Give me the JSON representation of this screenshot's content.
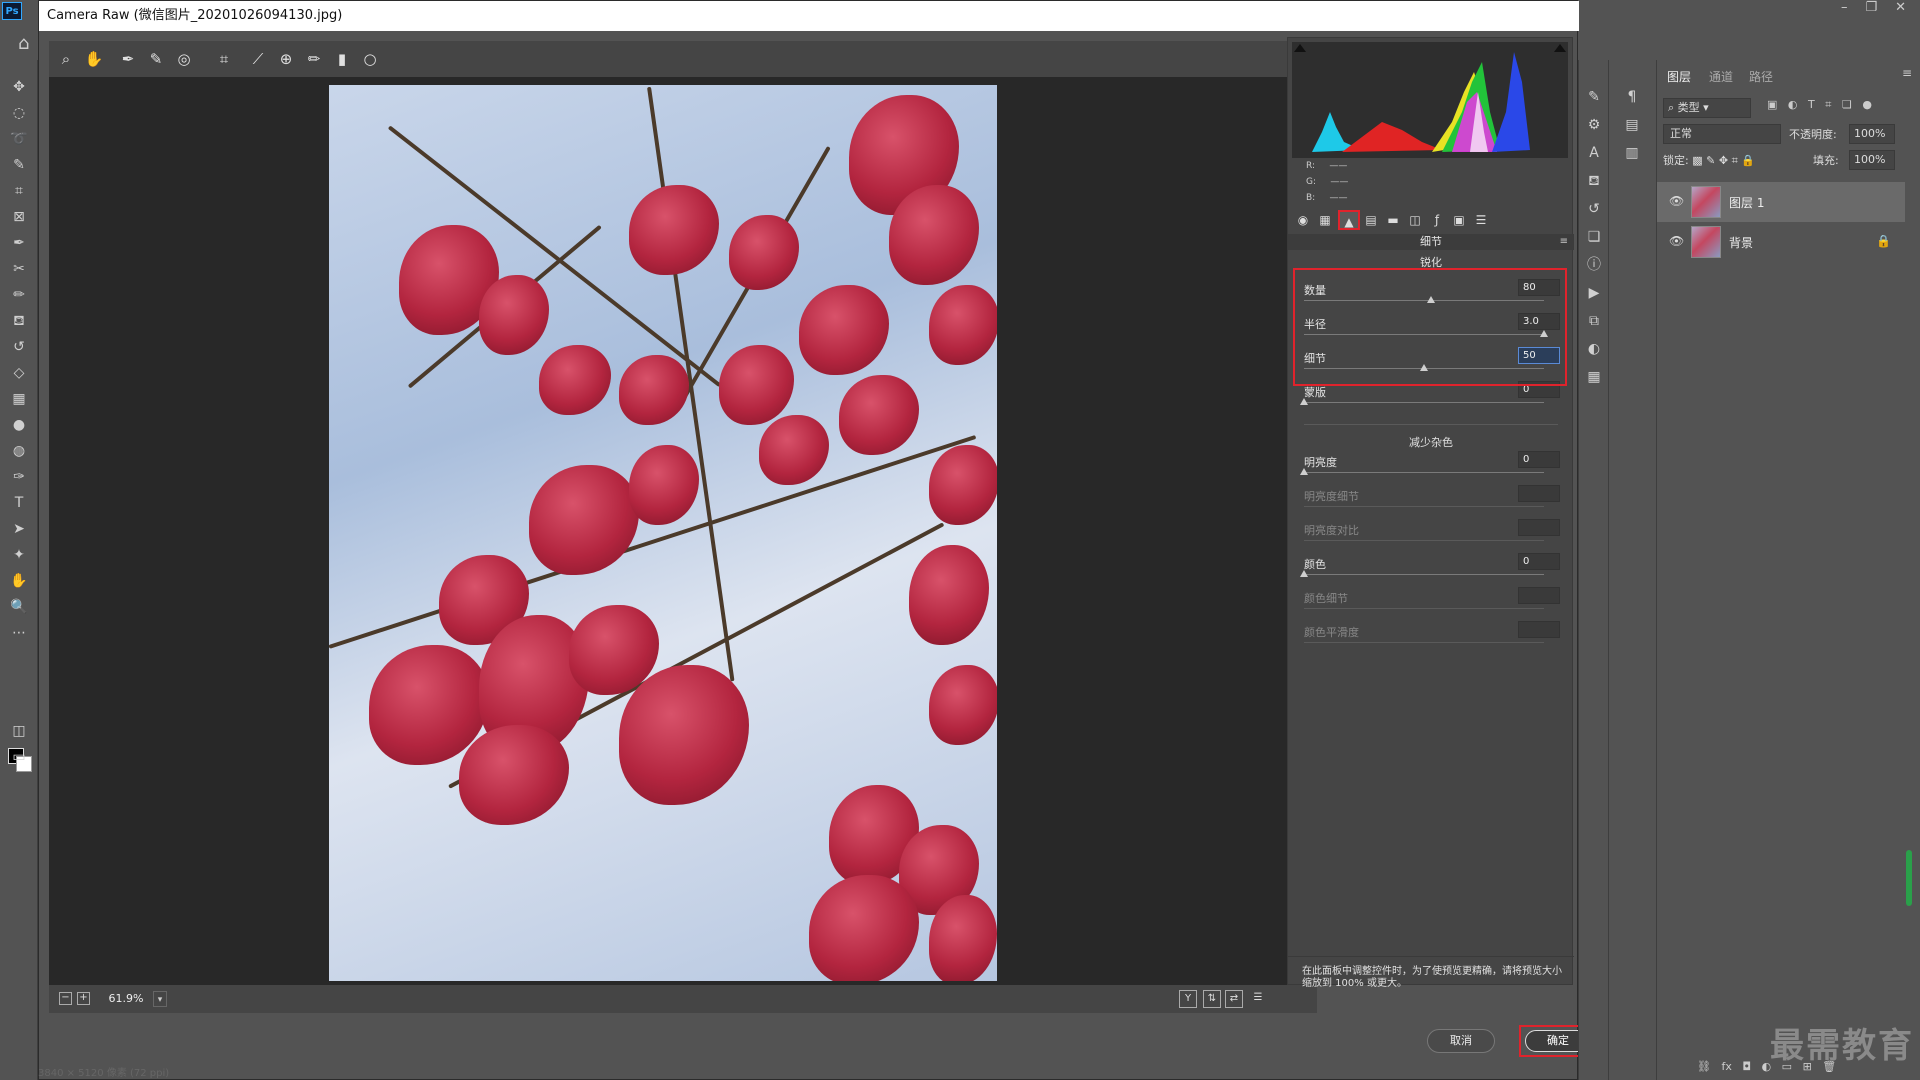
{
  "dialog": {
    "title": "Camera Raw (微信图片_20201026094130.jpg)"
  },
  "app": {
    "logo_text": "Ps",
    "window_controls": [
      "–",
      "❐",
      "✕"
    ]
  },
  "histogram": {
    "rgb": {
      "r": "R:",
      "g": "G:",
      "b": "B:",
      "r_val": "——",
      "g_val": "——",
      "b_val": "——"
    }
  },
  "panel": {
    "title": "细节",
    "sharpen": {
      "title": "锐化",
      "amount": {
        "label": "数量",
        "value": "80",
        "level": 0.53
      },
      "radius": {
        "label": "半径",
        "value": "3.0",
        "level": 1.0
      },
      "detail": {
        "label": "细节",
        "value": "50",
        "level": 0.5
      },
      "masking": {
        "label": "蒙版",
        "value": "0",
        "level": 0
      }
    },
    "noise": {
      "title": "减少杂色",
      "luminance": {
        "label": "明亮度",
        "value": "0",
        "level": 0
      },
      "luminance_detail": {
        "label": "明亮度细节",
        "value": ""
      },
      "luminance_contrast": {
        "label": "明亮度对比",
        "value": ""
      },
      "color": {
        "label": "颜色",
        "value": "0",
        "level": 0
      },
      "color_detail": {
        "label": "颜色细节",
        "value": ""
      },
      "color_smoothness": {
        "label": "颜色平滑度",
        "value": ""
      }
    },
    "note": "在此面板中调整控件时，为了使预览更精确，请将预览大小缩放到 100% 或更大。"
  },
  "statusbar": {
    "zoom": "61.9%",
    "zoom_minus": "−",
    "zoom_plus": "+",
    "view_y": "Y"
  },
  "buttons": {
    "cancel": "取消",
    "ok": "确定"
  },
  "layers": {
    "tabs": [
      "图层",
      "通道",
      "路径"
    ],
    "filter": "类型",
    "blend_mode": "正常",
    "opacity_label": "不透明度:",
    "opacity_value": "100%",
    "lock_label": "锁定:",
    "fill_label": "填充:",
    "fill_value": "100%",
    "items": [
      {
        "name": "图层 1",
        "selected": true
      },
      {
        "name": "背景",
        "selected": false
      }
    ]
  },
  "watermark": "最需教育",
  "behind_status": "3840 × 5120 像素 (72 ppi)",
  "colors": {
    "highlight": "#e0232c",
    "panel_bg": "#454545",
    "app_bg": "#535353"
  }
}
